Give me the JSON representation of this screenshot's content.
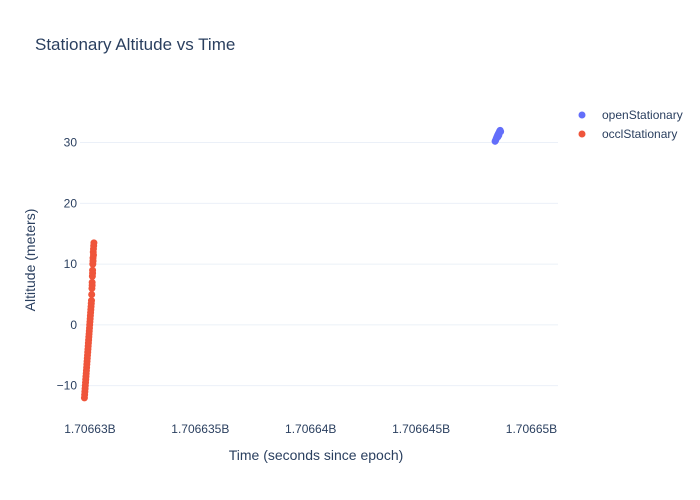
{
  "chart_data": {
    "type": "scatter",
    "title": "Stationary Altitude vs Time",
    "xlabel": "Time (seconds since epoch)",
    "ylabel": "Altitude (meters)",
    "xlim": [
      1706629550,
      1706651200
    ],
    "ylim": [
      -14,
      37
    ],
    "xticks": [
      1706630000,
      1706635000,
      1706640000,
      1706645000,
      1706650000
    ],
    "xtick_labels": [
      "1.70663B",
      "1.706635B",
      "1.70664B",
      "1.706645B",
      "1.70665B"
    ],
    "yticks": [
      -10,
      0,
      10,
      20,
      30
    ],
    "ytick_labels": [
      "−10",
      "0",
      "10",
      "20",
      "30"
    ],
    "grid": true,
    "legend": "top-right",
    "series": [
      {
        "name": "openStationary",
        "color": "#636efa",
        "points": [
          [
            1706648350,
            30.2
          ],
          [
            1706648380,
            30.4
          ],
          [
            1706648400,
            30.6
          ],
          [
            1706648420,
            30.8
          ],
          [
            1706648440,
            31.0
          ],
          [
            1706648460,
            31.1
          ],
          [
            1706648480,
            31.3
          ],
          [
            1706648500,
            31.4
          ],
          [
            1706648520,
            31.6
          ],
          [
            1706648540,
            31.7
          ],
          [
            1706648560,
            31.9
          ],
          [
            1706648580,
            32.0
          ],
          [
            1706648600,
            31.8
          ],
          [
            1706648470,
            30.9
          ],
          [
            1706648520,
            31.2
          ]
        ]
      },
      {
        "name": "occlStationary",
        "color": "#ef553b",
        "points": [
          [
            1706629750,
            -12.0
          ],
          [
            1706629760,
            -11.5
          ],
          [
            1706629770,
            -11.0
          ],
          [
            1706629780,
            -10.5
          ],
          [
            1706629790,
            -10.0
          ],
          [
            1706629800,
            -9.5
          ],
          [
            1706629810,
            -9.0
          ],
          [
            1706629820,
            -8.5
          ],
          [
            1706629830,
            -8.0
          ],
          [
            1706629840,
            -7.5
          ],
          [
            1706629850,
            -7.0
          ],
          [
            1706629860,
            -6.5
          ],
          [
            1706629870,
            -6.0
          ],
          [
            1706629880,
            -5.5
          ],
          [
            1706629890,
            -5.0
          ],
          [
            1706629900,
            -4.5
          ],
          [
            1706629910,
            -4.0
          ],
          [
            1706629920,
            -3.5
          ],
          [
            1706629930,
            -3.0
          ],
          [
            1706629940,
            -2.5
          ],
          [
            1706629950,
            -2.0
          ],
          [
            1706629960,
            -1.5
          ],
          [
            1706629970,
            -1.0
          ],
          [
            1706629980,
            -0.5
          ],
          [
            1706629990,
            0.0
          ],
          [
            1706630000,
            0.5
          ],
          [
            1706630010,
            1.0
          ],
          [
            1706630020,
            1.5
          ],
          [
            1706630030,
            2.0
          ],
          [
            1706630040,
            2.5
          ],
          [
            1706630050,
            3.0
          ],
          [
            1706630060,
            3.5
          ],
          [
            1706630070,
            4.0
          ],
          [
            1706630080,
            5.0
          ],
          [
            1706630090,
            6.0
          ],
          [
            1706630100,
            7.0
          ],
          [
            1706630110,
            8.0
          ],
          [
            1706630120,
            9.0
          ],
          [
            1706630130,
            10.0
          ],
          [
            1706630140,
            11.0
          ],
          [
            1706630150,
            12.0
          ],
          [
            1706630160,
            12.5
          ],
          [
            1706630170,
            13.0
          ],
          [
            1706630180,
            13.5
          ],
          [
            1706630100,
            6.5
          ],
          [
            1706630120,
            8.5
          ],
          [
            1706630140,
            10.5
          ],
          [
            1706630160,
            11.5
          ]
        ]
      }
    ]
  }
}
